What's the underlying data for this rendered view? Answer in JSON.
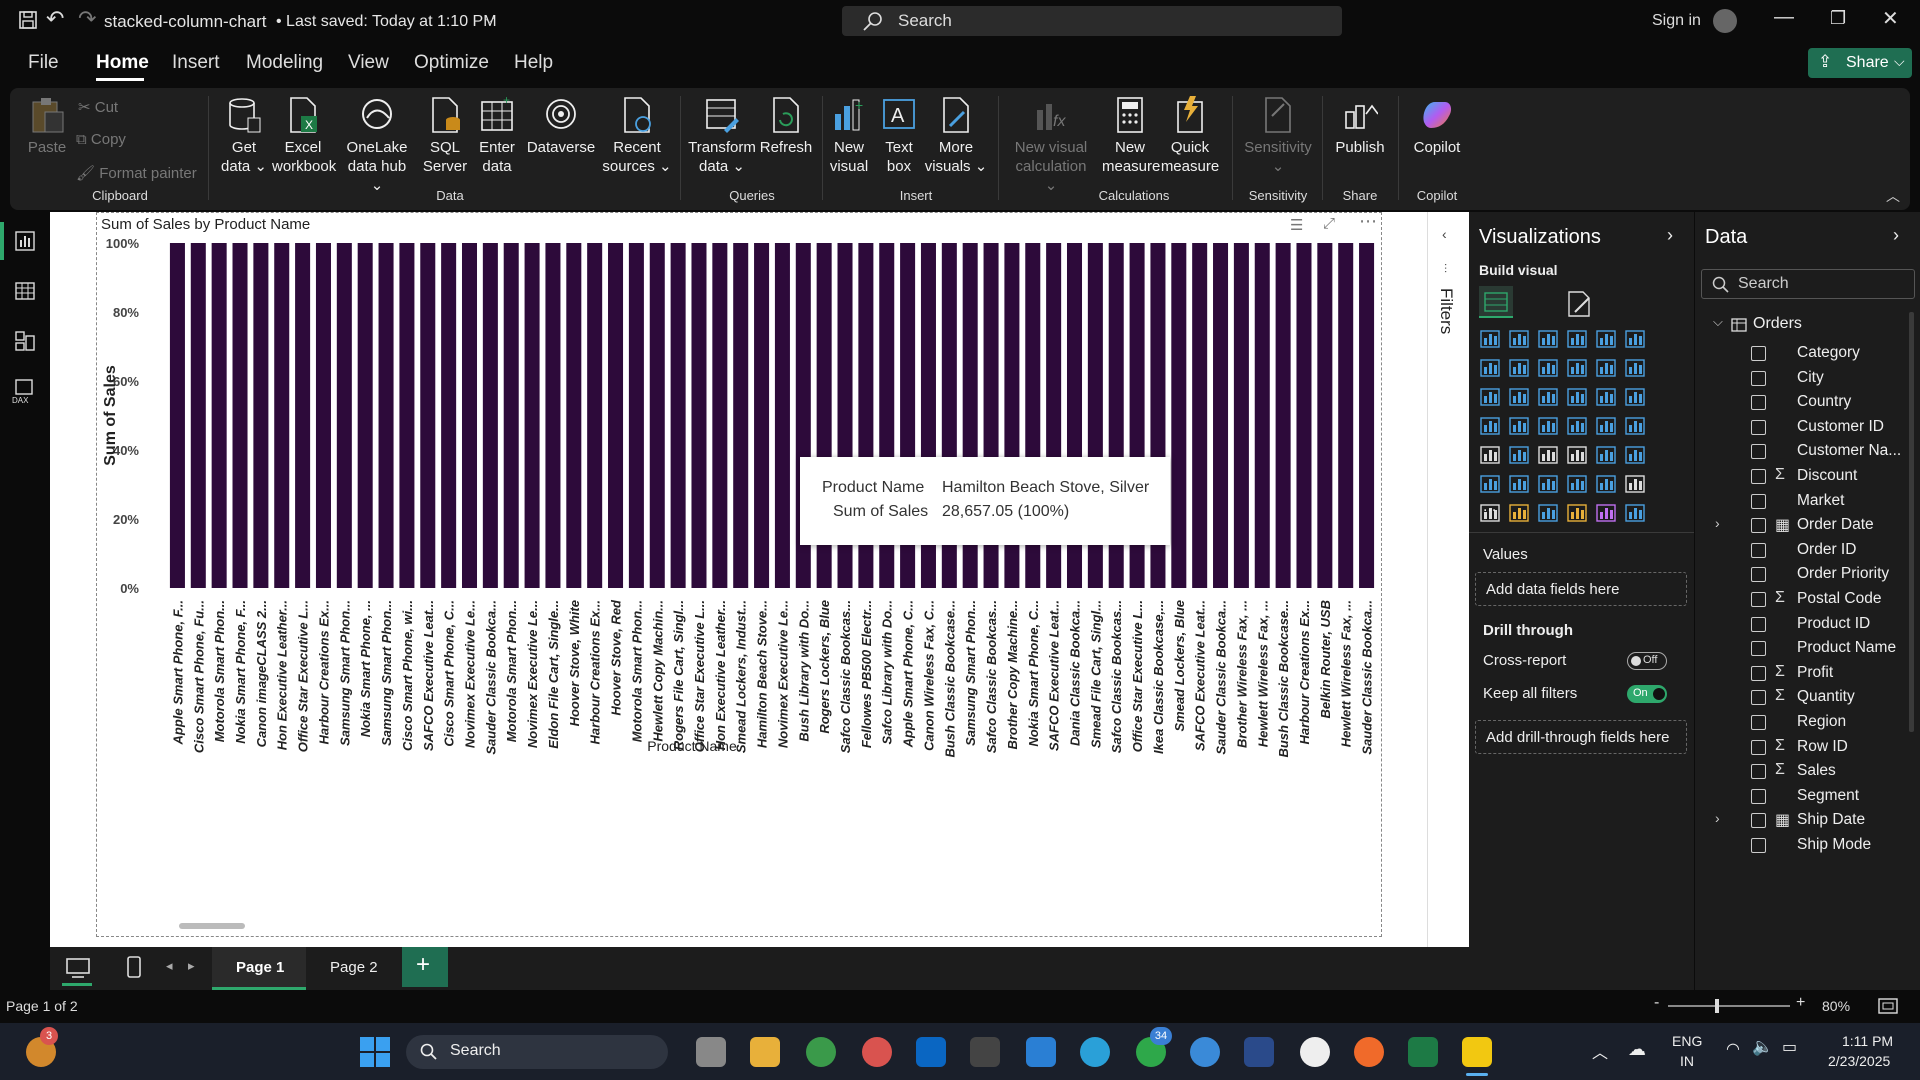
{
  "window": {
    "title": "stacked-column-chart",
    "saved": "• Last saved: Today at 1:10 PM",
    "search_placeholder": "Search",
    "signin": "Sign in",
    "share": "Share"
  },
  "menu": [
    "File",
    "Home",
    "Insert",
    "Modeling",
    "View",
    "Optimize",
    "Help"
  ],
  "ribbon": {
    "clipboard": {
      "paste": "Paste",
      "cut": "Cut",
      "copy": "Copy",
      "format_painter": "Format painter",
      "group": "Clipboard"
    },
    "data": {
      "get_data": "Get data ⌄",
      "excel": "Excel workbook",
      "onelake": "OneLake data hub ⌄",
      "sql": "SQL Server",
      "enter": "Enter data",
      "dataverse": "Dataverse",
      "recent": "Recent sources ⌄",
      "group": "Data"
    },
    "queries": {
      "transform": "Transform data ⌄",
      "refresh": "Refresh",
      "group": "Queries"
    },
    "insert": {
      "new_visual": "New visual",
      "text_box": "Text box",
      "more": "More visuals ⌄",
      "group": "Insert"
    },
    "calculations": {
      "new_calc": "New visual calculation ⌄",
      "new_measure": "New measure",
      "quick_measure": "Quick measure",
      "group": "Calculations"
    },
    "sensitivity": {
      "label": "Sensitivity ⌄",
      "group": "Sensitivity"
    },
    "share": {
      "publish": "Publish",
      "group": "Share"
    },
    "copilot": {
      "label": "Copilot",
      "group": "Copilot"
    }
  },
  "chart_data": {
    "type": "bar",
    "title": "Sum of Sales by Product Name",
    "xlabel": "Product Name",
    "ylabel": "Sum of Sales",
    "ylim": [
      0,
      100
    ],
    "y_ticks": [
      "100%",
      "80%",
      "60%",
      "40%",
      "20%",
      "0%"
    ],
    "bar_color": "#2d0a3a",
    "categories": [
      "Apple Smart Phone, F...",
      "Cisco Smart Phone, Fu...",
      "Motorola Smart Phon...",
      "Nokia Smart Phone, F...",
      "Canon imageCLASS 2...",
      "Hon Executive Leather...",
      "Office Star Executive L...",
      "Harbour Creations Ex...",
      "Samsung Smart Phon...",
      "Nokia Smart Phone, ...",
      "Samsung Smart Phon...",
      "Cisco Smart Phone, wi...",
      "SAFCO Executive Leat...",
      "Cisco Smart Phone, C...",
      "Novimex Executive Le...",
      "Sauder Classic Bookca...",
      "Motorola Smart Phon...",
      "Novimex Executive Le...",
      "Eldon File Cart, Single...",
      "Hoover Stove, White",
      "Harbour Creations Ex...",
      "Hoover Stove, Red",
      "Motorola Smart Phon...",
      "Hewlett Copy Machin...",
      "Rogers File Cart, Singl...",
      "Office Star Executive L...",
      "Hon Executive Leather...",
      "Smead Lockers, Indust...",
      "Hamilton Beach Stove...",
      "Novimex Executive Le...",
      "Bush Library with Do...",
      "Rogers Lockers, Blue",
      "Safco Classic Bookcas...",
      "Fellowes PB500 Electr...",
      "Safco Library with Do...",
      "Apple Smart Phone, C...",
      "Canon Wireless Fax, C...",
      "Bush Classic Bookcase...",
      "Samsung Smart Phon...",
      "Safco Classic Bookcas...",
      "Brother Copy Machine...",
      "Nokia Smart Phone, C...",
      "SAFCO Executive Leat...",
      "Dania Classic Bookca...",
      "Smead File Cart, Singl...",
      "Safco Classic Bookcas...",
      "Office Star Executive L...",
      "Ikea Classic Bookcase,...",
      "Smead Lockers, Blue",
      "SAFCO Executive Leat...",
      "Sauder Classic Bookca...",
      "Brother Wireless Fax, ...",
      "Hewlett Wireless Fax, ...",
      "Bush Classic Bookcase...",
      "Harbour Creations Ex...",
      "Belkin Router, USB",
      "Hewlett Wireless Fax, ...",
      "Sauder Classic Bookca..."
    ],
    "values": [
      100,
      100,
      100,
      100,
      100,
      100,
      100,
      100,
      100,
      100,
      100,
      100,
      100,
      100,
      100,
      100,
      100,
      100,
      100,
      100,
      100,
      100,
      100,
      100,
      100,
      100,
      100,
      100,
      100,
      100,
      100,
      100,
      100,
      100,
      100,
      100,
      100,
      100,
      100,
      100,
      100,
      100,
      100,
      100,
      100,
      100,
      100,
      100,
      100,
      100,
      100,
      100,
      100,
      100,
      100,
      100,
      100,
      100
    ]
  },
  "tooltip": {
    "k1": "Product Name",
    "v1": "Hamilton Beach Stove, Silver",
    "k2": "Sum of Sales",
    "v2": "28,657.05 (100%)"
  },
  "filters_label": "Filters",
  "viz": {
    "title": "Visualizations",
    "build": "Build visual",
    "values": "Values",
    "add_fields": "Add data fields here",
    "drill": "Drill through",
    "cross": "Cross-report",
    "cross_state": "Off",
    "keep": "Keep all filters",
    "keep_state": "On",
    "add_drill": "Add drill-through fields here",
    "more": "..."
  },
  "data": {
    "title": "Data",
    "search": "Search",
    "table": "Orders",
    "fields": [
      {
        "name": "Category",
        "sigma": "",
        "expand": false,
        "cal": false
      },
      {
        "name": "City",
        "sigma": "",
        "expand": false,
        "cal": false
      },
      {
        "name": "Country",
        "sigma": "",
        "expand": false,
        "cal": false
      },
      {
        "name": "Customer ID",
        "sigma": "",
        "expand": false,
        "cal": false
      },
      {
        "name": "Customer Na...",
        "sigma": "",
        "expand": false,
        "cal": false
      },
      {
        "name": "Discount",
        "sigma": "Σ",
        "expand": false,
        "cal": false
      },
      {
        "name": "Market",
        "sigma": "",
        "expand": false,
        "cal": false
      },
      {
        "name": "Order Date",
        "sigma": "",
        "expand": true,
        "cal": true
      },
      {
        "name": "Order ID",
        "sigma": "",
        "expand": false,
        "cal": false
      },
      {
        "name": "Order Priority",
        "sigma": "",
        "expand": false,
        "cal": false
      },
      {
        "name": "Postal Code",
        "sigma": "Σ",
        "expand": false,
        "cal": false
      },
      {
        "name": "Product ID",
        "sigma": "",
        "expand": false,
        "cal": false
      },
      {
        "name": "Product Name",
        "sigma": "",
        "expand": false,
        "cal": false
      },
      {
        "name": "Profit",
        "sigma": "Σ",
        "expand": false,
        "cal": false
      },
      {
        "name": "Quantity",
        "sigma": "Σ",
        "expand": false,
        "cal": false
      },
      {
        "name": "Region",
        "sigma": "",
        "expand": false,
        "cal": false
      },
      {
        "name": "Row ID",
        "sigma": "Σ",
        "expand": false,
        "cal": false
      },
      {
        "name": "Sales",
        "sigma": "Σ",
        "expand": false,
        "cal": false
      },
      {
        "name": "Segment",
        "sigma": "",
        "expand": false,
        "cal": false
      },
      {
        "name": "Ship Date",
        "sigma": "",
        "expand": true,
        "cal": true
      },
      {
        "name": "Ship Mode",
        "sigma": "",
        "expand": false,
        "cal": false
      }
    ]
  },
  "pages": {
    "page1": "Page 1",
    "page2": "Page 2",
    "add": "+"
  },
  "status": {
    "page": "Page 1 of 2",
    "zoom": "80%"
  },
  "taskbar": {
    "search": "Search",
    "lang1": "ENG",
    "lang2": "IN",
    "time": "1:11 PM",
    "date": "2/23/2025",
    "weather_badge": "3",
    "whatsapp_badge": "34"
  }
}
